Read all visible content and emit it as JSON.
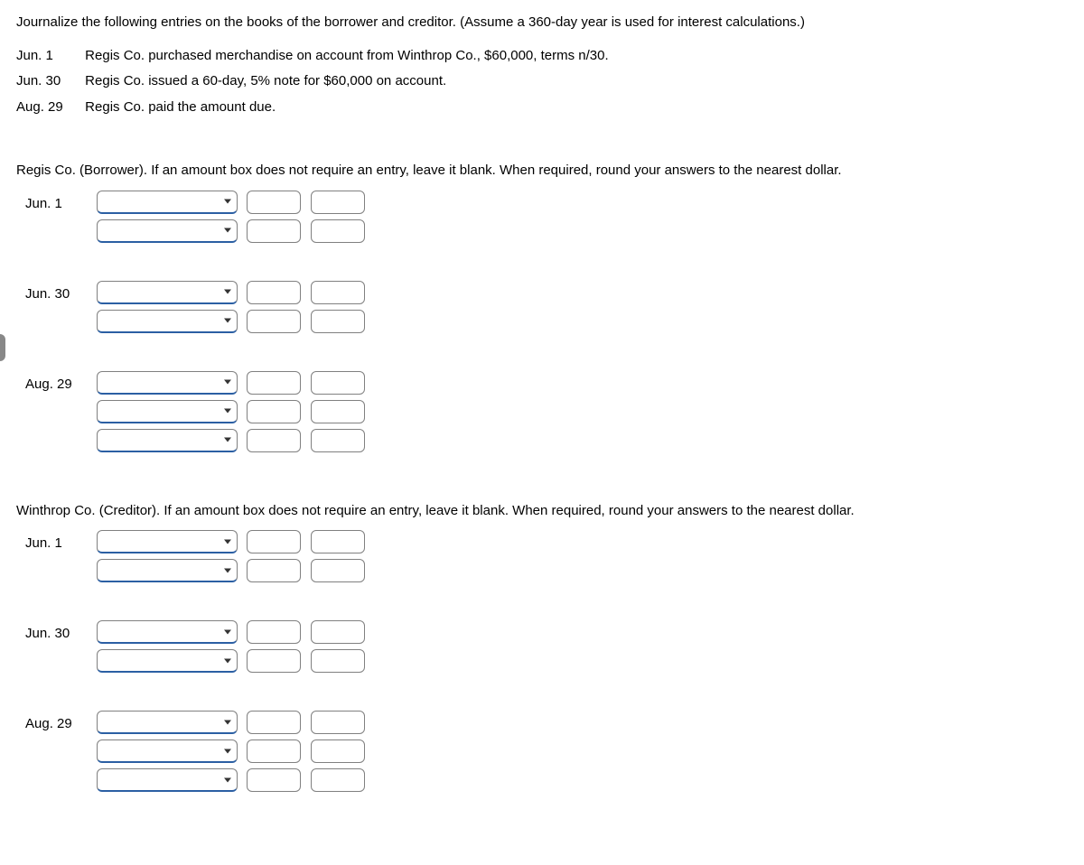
{
  "intro": "Journalize the following entries on the books of the borrower and creditor. (Assume a 360-day year is used for interest calculations.)",
  "transactions": [
    {
      "date": "Jun. 1",
      "desc": "Regis Co. purchased merchandise on account from Winthrop Co., $60,000, terms n/30."
    },
    {
      "date": "Jun. 30",
      "desc": "Regis Co. issued a 60-day, 5% note for $60,000 on account."
    },
    {
      "date": "Aug. 29",
      "desc": "Regis Co. paid the amount due."
    }
  ],
  "sections": [
    {
      "heading": "Regis Co. (Borrower). If an amount box does not require an entry, leave it blank. When required, round your answers to the nearest dollar.",
      "entries": [
        {
          "date": "Jun. 1",
          "rows": 2
        },
        {
          "date": "Jun. 30",
          "rows": 2
        },
        {
          "date": "Aug. 29",
          "rows": 3
        }
      ]
    },
    {
      "heading": "Winthrop Co. (Creditor). If an amount box does not require an entry, leave it blank. When required, round your answers to the nearest dollar.",
      "entries": [
        {
          "date": "Jun. 1",
          "rows": 2
        },
        {
          "date": "Jun. 30",
          "rows": 2
        },
        {
          "date": "Aug. 29",
          "rows": 3
        }
      ]
    }
  ]
}
